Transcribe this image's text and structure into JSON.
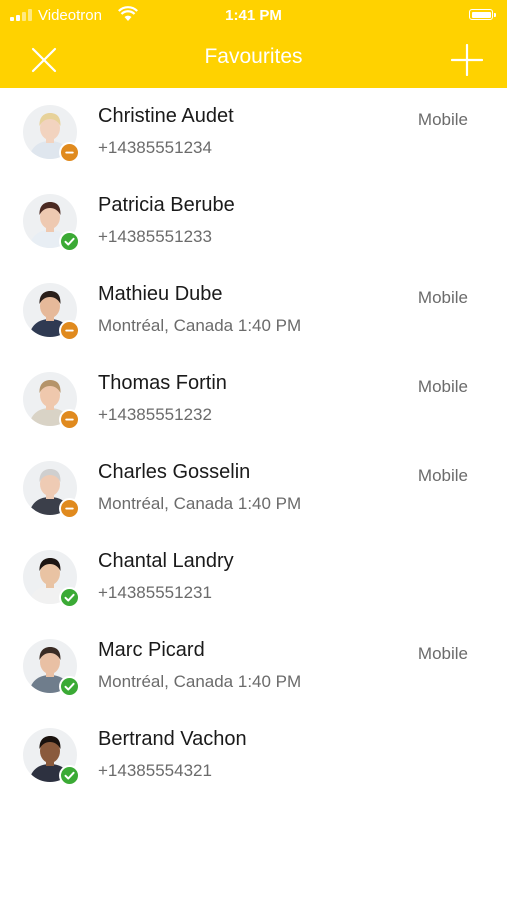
{
  "status_bar": {
    "carrier": "Videotron",
    "time": "1:41 PM"
  },
  "nav": {
    "title": "Favourites",
    "close_icon": "close-icon",
    "add_icon": "plus-icon"
  },
  "colors": {
    "accent": "#FFD200",
    "away": "#E08A1E",
    "available": "#3BAA35"
  },
  "contacts": [
    {
      "name": "Christine Audet",
      "detail": "+14385551234",
      "label": "Mobile",
      "presence": "away",
      "skin": "#f2d3bf",
      "hair": "#e7d29a",
      "shirt": "#dfe6ee"
    },
    {
      "name": "Patricia Berube",
      "detail": "+14385551233",
      "label": "",
      "presence": "available",
      "skin": "#eec9b1",
      "hair": "#4b2a22",
      "shirt": "#e8eef4"
    },
    {
      "name": "Mathieu Dube",
      "detail": "Montréal, Canada 1:40 PM",
      "label": "Mobile",
      "presence": "away",
      "skin": "#e6b99a",
      "hair": "#2a1f1a",
      "shirt": "#2f3a52"
    },
    {
      "name": "Thomas Fortin",
      "detail": "+14385551232",
      "label": "Mobile",
      "presence": "away",
      "skin": "#efc8ad",
      "hair": "#b5946a",
      "shirt": "#d9d3c6"
    },
    {
      "name": "Charles Gosselin",
      "detail": "Montréal, Canada 1:40 PM",
      "label": "Mobile",
      "presence": "away",
      "skin": "#efcbb4",
      "hair": "#cfcfcf",
      "shirt": "#3b3f4a"
    },
    {
      "name": "Chantal Landry",
      "detail": "+14385551231",
      "label": "",
      "presence": "available",
      "skin": "#e9c3a3",
      "hair": "#1c1512",
      "shirt": "#f1f1f1"
    },
    {
      "name": "Marc Picard",
      "detail": "Montréal, Canada 1:40 PM",
      "label": "Mobile",
      "presence": "available",
      "skin": "#e9c0a4",
      "hair": "#3a2c25",
      "shirt": "#6f7d8c"
    },
    {
      "name": "Bertrand Vachon",
      "detail": "+14385554321",
      "label": "",
      "presence": "available",
      "skin": "#8a5a3c",
      "hair": "#1a120e",
      "shirt": "#2d3140"
    }
  ]
}
